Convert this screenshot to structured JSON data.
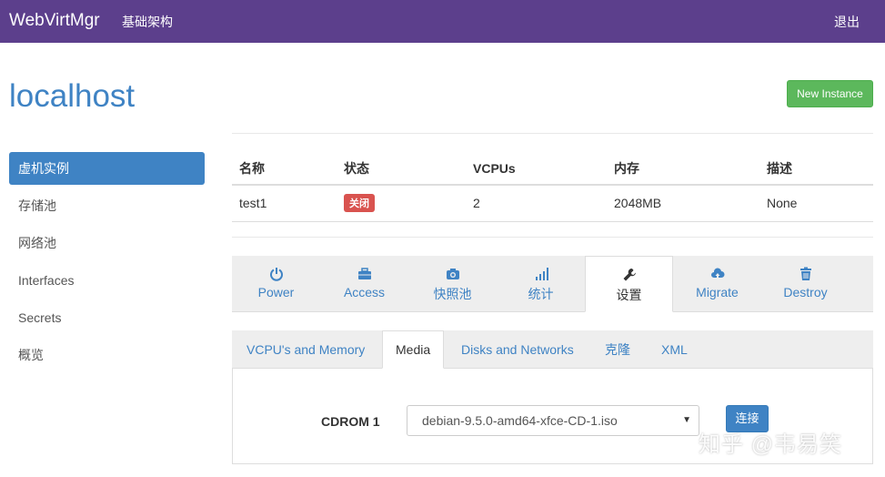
{
  "navbar": {
    "brand": "WebVirtMgr",
    "infrastructure_link": "基础架构",
    "logout": "退出"
  },
  "header": {
    "title": "localhost",
    "new_instance_label": "New Instance"
  },
  "sidebar": {
    "items": [
      {
        "label": "虚机实例",
        "active": true
      },
      {
        "label": "存储池"
      },
      {
        "label": "网络池"
      },
      {
        "label": "Interfaces"
      },
      {
        "label": "Secrets"
      },
      {
        "label": "概览"
      }
    ]
  },
  "instances": {
    "columns": [
      "名称",
      "状态",
      "VCPUs",
      "内存",
      "描述"
    ],
    "rows": [
      {
        "name": "test1",
        "status": "关闭",
        "vcpus": "2",
        "memory": "2048MB",
        "description": "None"
      }
    ]
  },
  "action_tabs": [
    {
      "label": "Power",
      "icon": "power-icon"
    },
    {
      "label": "Access",
      "icon": "briefcase-icon"
    },
    {
      "label": "快照池",
      "icon": "camera-icon"
    },
    {
      "label": "统计",
      "icon": "bar-chart-icon"
    },
    {
      "label": "设置",
      "icon": "wrench-icon",
      "active": true
    },
    {
      "label": "Migrate",
      "icon": "cloud-upload-icon"
    },
    {
      "label": "Destroy",
      "icon": "trash-icon"
    }
  ],
  "settings_tabs": [
    {
      "label": "VCPU's and Memory"
    },
    {
      "label": "Media",
      "active": true
    },
    {
      "label": "Disks and Networks"
    },
    {
      "label": "克隆"
    },
    {
      "label": "XML"
    }
  ],
  "media": {
    "cdrom_label": "CDROM 1",
    "iso_selected": "debian-9.5.0-amd64-xfce-CD-1.iso",
    "connect_label": "连接"
  },
  "watermark": "知乎 @韦易笑",
  "colors": {
    "navbar": "#5c3f8c",
    "accent": "#3f83c4",
    "success": "#5cb85c",
    "danger": "#d9534f"
  }
}
